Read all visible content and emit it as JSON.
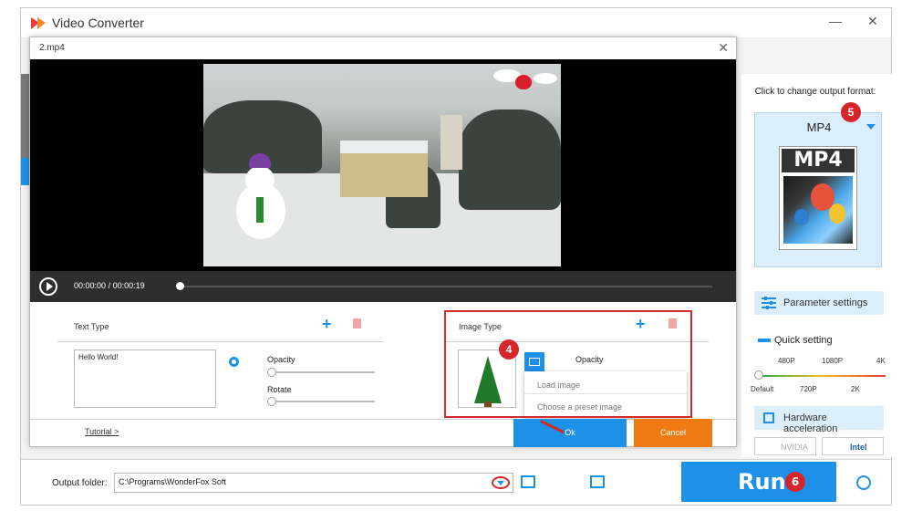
{
  "app": {
    "title": "Video Converter",
    "minimize": "—",
    "close": "✕"
  },
  "dialog": {
    "title": "2.mp4",
    "close": "✕",
    "player": {
      "current_time": "00:00:00",
      "separator": "/",
      "total_time": "00:00:19",
      "progress": 0.0
    },
    "text_section": {
      "label": "Text Type",
      "text_value": "Hello World!",
      "opacity_label": "Opacity",
      "rotate_label": "Rotate"
    },
    "image_section": {
      "label": "Image Type",
      "opacity_label": "Opacity",
      "menu": [
        "Load image",
        "Choose a preset image"
      ]
    },
    "tutorial_link": "Tutorial >",
    "ok_label": "Ok",
    "cancel_label": "Cancel"
  },
  "badges": {
    "b4": "4",
    "b5": "5",
    "b6": "6"
  },
  "right_panel": {
    "format_prompt": "Click to change output format:",
    "format_name": "MP4",
    "format_icon_text": "MP4",
    "param_label": "Parameter settings",
    "quick_setting_label": "Quick setting",
    "scale_top": [
      "480P",
      "1080P",
      "4K"
    ],
    "scale_bottom": [
      "Default",
      "720P",
      "2K"
    ],
    "hw_label": "Hardware acceleration",
    "gpu_nvidia": "NVIDIA",
    "gpu_intel": "Intel"
  },
  "bottom": {
    "output_label": "Output folder:",
    "output_path": "C:\\Programs\\WonderFox Soft",
    "run_label": "Run"
  },
  "colors": {
    "accent": "#1e90e8",
    "cancel": "#f07a12",
    "highlight": "#d02a2a"
  }
}
